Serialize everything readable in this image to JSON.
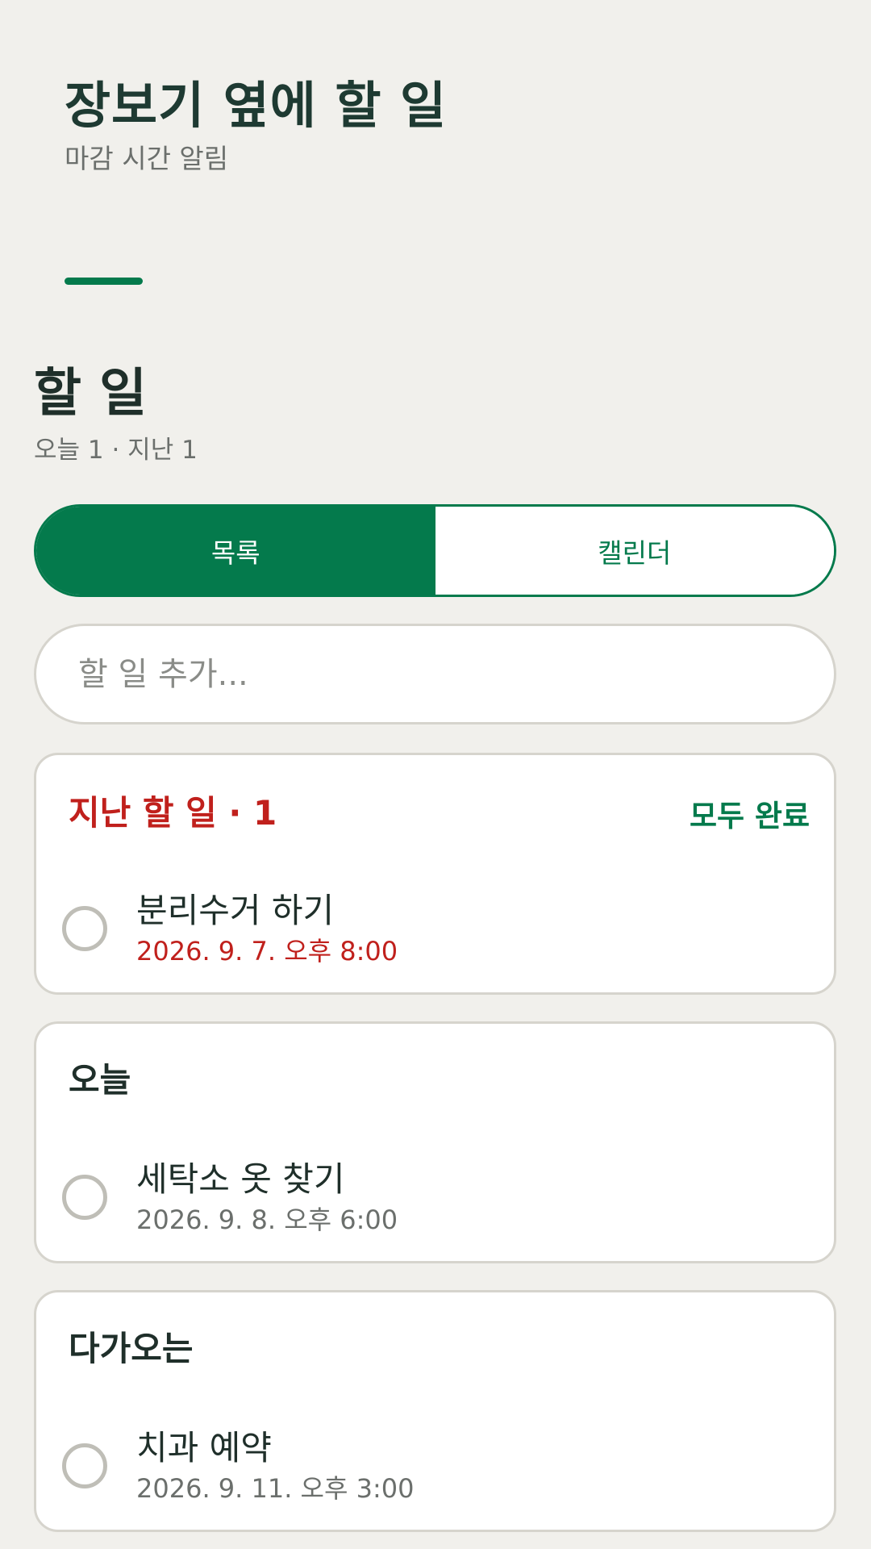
{
  "app": {
    "title": "장보기 옆에 할 일",
    "subtitle": "마감 시간 알림"
  },
  "section": {
    "title": "할 일",
    "summary": "오늘 1 · 지난 1"
  },
  "view_toggle": {
    "list_label": "목록",
    "calendar_label": "캘린더",
    "selected": "목록"
  },
  "add_task": {
    "placeholder": "할 일 추가...",
    "value": ""
  },
  "groups": {
    "overdue": {
      "title": "지난 할 일 · 1",
      "action_label": "모두 완료",
      "tasks": [
        {
          "name": "분리수거 하기",
          "due": "2026. 9. 7. 오후 8:00"
        }
      ]
    },
    "today": {
      "title": "오늘",
      "tasks": [
        {
          "name": "세탁소 옷 찾기",
          "due": "2026. 9. 8. 오후 6:00"
        }
      ]
    },
    "upcoming": {
      "title": "다가오는",
      "tasks": [
        {
          "name": "치과 예약",
          "due": "2026. 9. 11. 오후 3:00"
        }
      ]
    }
  },
  "colors": {
    "accent": "#047a4c",
    "overdue": "#c0201c",
    "background": "#f1f0ec"
  }
}
